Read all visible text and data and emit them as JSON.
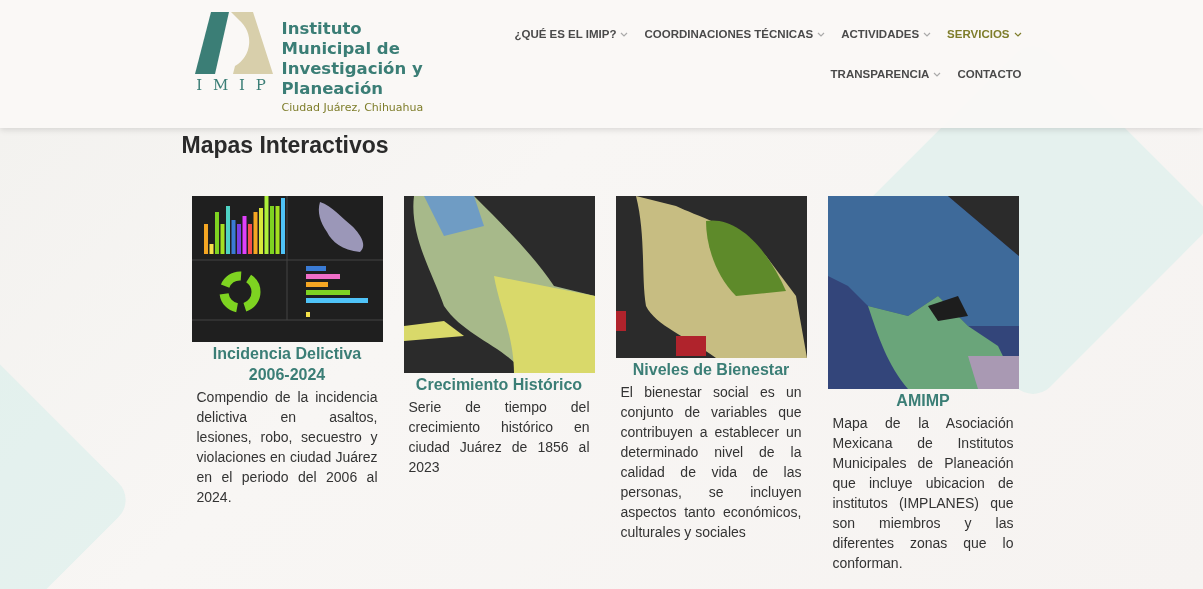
{
  "logo": {
    "letters": "I M I P",
    "title": "Instituto Municipal de Investigación y Planeación",
    "subtitle": "Ciudad Juárez, Chihuahua"
  },
  "nav": [
    {
      "label": "¿QUÉ ES EL IMIP?",
      "dropdown": true,
      "selected": false
    },
    {
      "label": "COORDINACIONES TÉCNICAS",
      "dropdown": true,
      "selected": false
    },
    {
      "label": "ACTIVIDADES",
      "dropdown": true,
      "selected": false
    },
    {
      "label": "SERVICIOS",
      "dropdown": true,
      "selected": true
    },
    {
      "label": "TRANSPARENCIA",
      "dropdown": true,
      "selected": false
    },
    {
      "label": "CONTACTO",
      "dropdown": false,
      "selected": false
    }
  ],
  "heading": "Mapas Interactivos",
  "cards": [
    {
      "kind": "dashboard",
      "title": "Incidencia Delictiva 2006-2024",
      "description": "Compendio de la incidencia delictiva en asaltos, lesiones, robo, secuestro y violaciones en ciudad Juárez en el periodo del 2006 al 2024."
    },
    {
      "kind": "city-map",
      "title": "Crecimiento Histórico",
      "description": "Serie de tiempo del crecimiento histórico en ciudad Juárez de 1856 al 2023"
    },
    {
      "kind": "welfare-map",
      "title": "Niveles de Bienestar",
      "description": "El bienestar social es un conjunto de variables que contribuyen a establecer un determinado nivel de la calidad de vida de las personas, se incluyen aspectos tanto económicos, culturales y sociales"
    },
    {
      "kind": "country-map",
      "title": "AMIMP",
      "description": "Mapa de la Asociación Mexicana de Institutos Municipales de Planeación que incluye ubicacion de institutos (IMPLANES) que son miembros  y las diferentes zonas que lo conforman."
    }
  ]
}
